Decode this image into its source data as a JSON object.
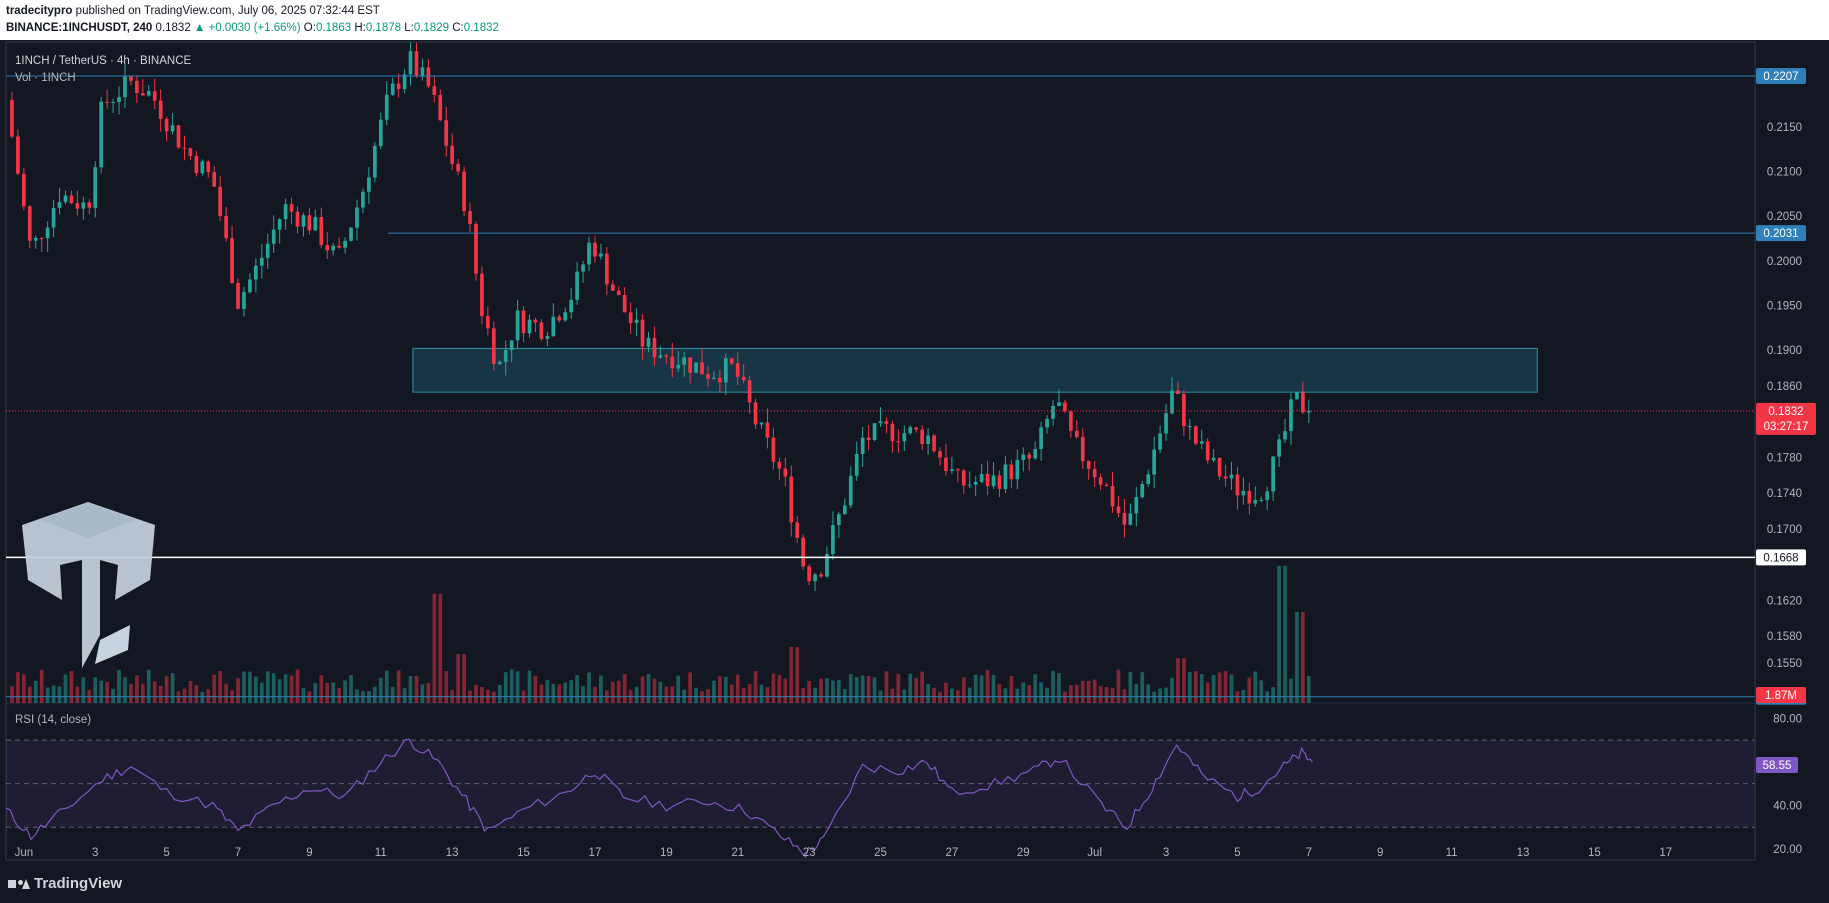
{
  "header": {
    "author": "tradecitypro",
    "published_text": "published on TradingView.com, July 06, 2025 07:32:44 EST",
    "symbol": "BINANCE:1INCHUSDT, 240",
    "last": "0.1832",
    "change": "▲ +0.0030 (+1.66%)",
    "o_label": "O:",
    "o": "0.1863",
    "h_label": "H:",
    "h": "0.1878",
    "l_label": "L:",
    "l": "0.1829",
    "c_label": "C:",
    "c": "0.1832"
  },
  "legend": {
    "title": "1INCH / TetherUS · 4h · BINANCE",
    "vol": "Vol · 1INCH"
  },
  "rsi_label": "RSI (14, close)",
  "footer": {
    "brand": "TradingView"
  },
  "colors": {
    "bg": "#131722",
    "up": "#26a69a",
    "down": "#f23645",
    "hline": "#2962ff",
    "zone": "#1f6f7e",
    "rsi": "#7e57c2"
  },
  "chart_data": {
    "type": "candlestick",
    "symbol": "1INCH / TetherUS",
    "interval": "4h",
    "exchange": "BINANCE",
    "price_ticks": [
      "0.2150",
      "0.2100",
      "0.2050",
      "0.2000",
      "0.1950",
      "0.1900",
      "0.1860",
      "0.1780",
      "0.1740",
      "0.1700",
      "0.1620",
      "0.1580",
      "0.1550"
    ],
    "price_tick_values": [
      0.215,
      0.21,
      0.205,
      0.2,
      0.195,
      0.19,
      0.186,
      0.178,
      0.174,
      0.17,
      0.162,
      0.158,
      0.155
    ],
    "ylim": [
      0.1505,
      0.2245
    ],
    "x_ticks": [
      "Jun",
      "3",
      "5",
      "7",
      "9",
      "11",
      "13",
      "15",
      "17",
      "19",
      "21",
      "23",
      "25",
      "27",
      "29",
      "Jul",
      "3",
      "5",
      "7",
      "9",
      "11",
      "13",
      "15",
      "17"
    ],
    "x_tick_days": [
      1,
      3,
      5,
      7,
      9,
      11,
      13,
      15,
      17,
      19,
      21,
      23,
      25,
      27,
      29,
      31,
      33,
      35,
      37,
      39,
      41,
      43,
      45,
      47
    ],
    "xlim_days": [
      0.5,
      49.5
    ],
    "horizontal_levels": [
      {
        "label": "0.2207",
        "value": 0.2207
      },
      {
        "label": "0.2031",
        "value": 0.2031
      },
      {
        "label": "0.1668",
        "value": 0.1668
      },
      {
        "label": "0.1512",
        "value": 0.1512
      }
    ],
    "resistance_zone": {
      "low": 0.1853,
      "high": 0.1902,
      "from_day": 11.9,
      "to_day": 43.4
    },
    "current_price": {
      "label": "0.1832",
      "value": 0.1832,
      "countdown": "03:27:17"
    },
    "volume_label": "1.87M",
    "price_path": [
      [
        0.5,
        0.218
      ],
      [
        1.2,
        0.201
      ],
      [
        2.0,
        0.2075
      ],
      [
        2.8,
        0.206
      ],
      [
        3.2,
        0.2175
      ],
      [
        4.0,
        0.22
      ],
      [
        4.6,
        0.2185
      ],
      [
        5.5,
        0.2125
      ],
      [
        6.3,
        0.209
      ],
      [
        7.0,
        0.1955
      ],
      [
        7.5,
        0.199
      ],
      [
        8.3,
        0.206
      ],
      [
        9.1,
        0.204
      ],
      [
        9.8,
        0.2
      ],
      [
        10.5,
        0.208
      ],
      [
        11.2,
        0.218
      ],
      [
        11.8,
        0.2225
      ],
      [
        12.4,
        0.219
      ],
      [
        13.0,
        0.211
      ],
      [
        13.4,
        0.206
      ],
      [
        13.8,
        0.195
      ],
      [
        14.3,
        0.188
      ],
      [
        14.8,
        0.1935
      ],
      [
        15.6,
        0.1925
      ],
      [
        16.4,
        0.1965
      ],
      [
        16.9,
        0.2025
      ],
      [
        17.6,
        0.196
      ],
      [
        18.4,
        0.1905
      ],
      [
        19.4,
        0.189
      ],
      [
        20.2,
        0.1875
      ],
      [
        20.9,
        0.188
      ],
      [
        21.5,
        0.182
      ],
      [
        22.3,
        0.1755
      ],
      [
        22.9,
        0.165
      ],
      [
        23.3,
        0.1655
      ],
      [
        23.9,
        0.172
      ],
      [
        24.5,
        0.18
      ],
      [
        25.2,
        0.181
      ],
      [
        26.3,
        0.1805
      ],
      [
        27.2,
        0.175
      ],
      [
        28.2,
        0.1755
      ],
      [
        29.3,
        0.178
      ],
      [
        29.9,
        0.1845
      ],
      [
        30.4,
        0.1795
      ],
      [
        31.2,
        0.1755
      ],
      [
        31.9,
        0.17
      ],
      [
        32.6,
        0.178
      ],
      [
        33.2,
        0.1855
      ],
      [
        33.7,
        0.1805
      ],
      [
        34.3,
        0.177
      ],
      [
        35.0,
        0.1745
      ],
      [
        35.6,
        0.174
      ],
      [
        35.9,
        0.176
      ],
      [
        36.2,
        0.179
      ],
      [
        36.6,
        0.1845
      ],
      [
        37.0,
        0.1832
      ]
    ],
    "volume_spikes": [
      {
        "day": 12.6,
        "rel": 0.78
      },
      {
        "day": 13.2,
        "rel": 0.35
      },
      {
        "day": 22.6,
        "rel": 0.4
      },
      {
        "day": 33.4,
        "rel": 0.32
      },
      {
        "day": 36.3,
        "rel": 0.98
      },
      {
        "day": 36.7,
        "rel": 0.65
      }
    ],
    "rsi": {
      "period": 14,
      "ticks": [
        "80.00",
        "40.00",
        "20.00"
      ],
      "tick_values": [
        80,
        40,
        20
      ],
      "upper": 70,
      "middle": 50,
      "lower": 30,
      "ylim": [
        15,
        87
      ],
      "current": {
        "label": "58.55",
        "value": 58.55
      },
      "path": [
        [
          0.5,
          38
        ],
        [
          1.2,
          26
        ],
        [
          2.0,
          36
        ],
        [
          3.2,
          52
        ],
        [
          4.0,
          58
        ],
        [
          5.0,
          46
        ],
        [
          6.3,
          40
        ],
        [
          7.0,
          28
        ],
        [
          8.0,
          40
        ],
        [
          9.0,
          48
        ],
        [
          10.0,
          44
        ],
        [
          11.0,
          60
        ],
        [
          11.8,
          70
        ],
        [
          12.6,
          60
        ],
        [
          13.4,
          42
        ],
        [
          14.0,
          28
        ],
        [
          15.0,
          38
        ],
        [
          16.2,
          46
        ],
        [
          17.0,
          56
        ],
        [
          17.8,
          44
        ],
        [
          19.0,
          40
        ],
        [
          20.2,
          42
        ],
        [
          21.2,
          38
        ],
        [
          22.2,
          26
        ],
        [
          22.9,
          18
        ],
        [
          23.4,
          24
        ],
        [
          24.5,
          58
        ],
        [
          25.5,
          56
        ],
        [
          26.3,
          60
        ],
        [
          27.0,
          46
        ],
        [
          28.2,
          50
        ],
        [
          29.3,
          56
        ],
        [
          30.0,
          62
        ],
        [
          31.2,
          40
        ],
        [
          31.9,
          30
        ],
        [
          32.6,
          48
        ],
        [
          33.3,
          68
        ],
        [
          34.0,
          54
        ],
        [
          35.0,
          44
        ],
        [
          35.6,
          48
        ],
        [
          36.3,
          58
        ],
        [
          36.8,
          64
        ],
        [
          37.1,
          60
        ]
      ]
    }
  }
}
